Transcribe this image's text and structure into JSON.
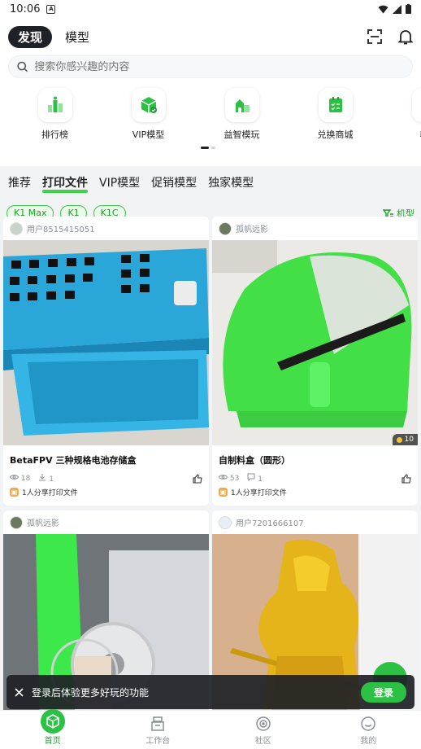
{
  "status": {
    "time": "10:06"
  },
  "header": {
    "tab_active": "发现",
    "tab_other": "模型"
  },
  "search": {
    "placeholder": "搜索你感兴趣的内容"
  },
  "quick": [
    {
      "label": "排行榜",
      "icon": "trophy-icon"
    },
    {
      "label": "VIP模型",
      "icon": "vip-cube-icon"
    },
    {
      "label": "益智模玩",
      "icon": "puzzle-icon"
    },
    {
      "label": "兑换商城",
      "icon": "shop-icon"
    },
    {
      "label": "教育",
      "icon": "education-icon"
    }
  ],
  "categories": [
    "推荐",
    "打印文件",
    "VIP模型",
    "促销模型",
    "独家模型"
  ],
  "active_category": "打印文件",
  "filters": [
    "K1 Max",
    "K1",
    "K1C"
  ],
  "machine_label": "机型",
  "cards": [
    {
      "user": "用户8515415051",
      "title": "BetaFPV 三种规格电池存储盒",
      "views": "18",
      "downloads": "1",
      "share": "1人分享打印文件"
    },
    {
      "user": "孤帆远影",
      "title": "自制料盒（圆形）",
      "views": "53",
      "comments": "1",
      "share": "1人分享打印文件",
      "badge": "10"
    },
    {
      "user": "孤帆远影"
    },
    {
      "user": "用户7201666107"
    }
  ],
  "login": {
    "text": "登录后体验更多好玩的功能",
    "button": "登录"
  },
  "nav": [
    "首页",
    "工作台",
    "社区",
    "我的"
  ],
  "colors": {
    "accent": "#2cc144",
    "dark": "#1e2126"
  }
}
